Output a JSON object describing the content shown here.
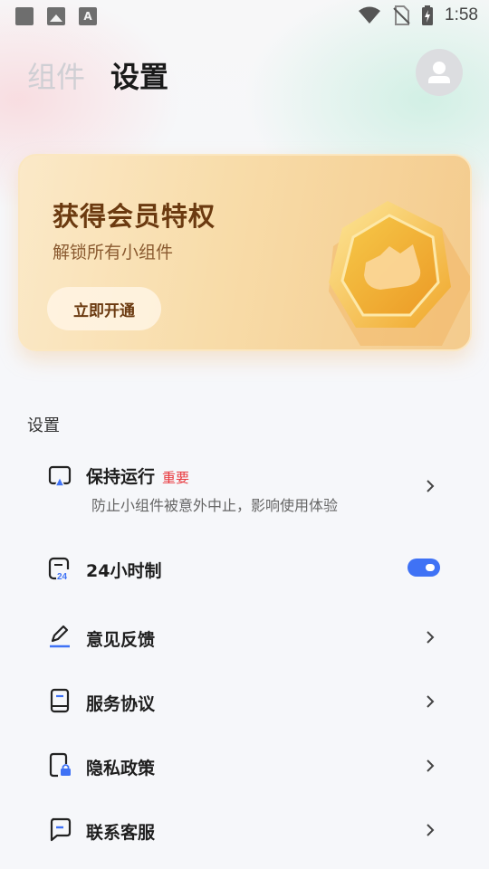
{
  "status_bar": {
    "time": "1:58",
    "left_icons": [
      "square-notification-icon",
      "image-notification-icon",
      "text-notification-icon"
    ],
    "right_icons": [
      "wifi-icon",
      "no-sim-icon",
      "battery-charging-icon"
    ]
  },
  "header": {
    "tabs": [
      {
        "label": "组件",
        "active": false
      },
      {
        "label": "设置",
        "active": true
      }
    ],
    "avatar_icon": "user-avatar-icon"
  },
  "banner": {
    "title": "获得会员特权",
    "subtitle": "解锁所有小组件",
    "button_label": "立即开通",
    "art_icon": "crown-hexagon-badge-icon"
  },
  "settings": {
    "section_label": "设置",
    "items": [
      {
        "label": "保持运行",
        "tag": "重要",
        "description": "防止小组件被意外中止，影响使用体验",
        "icon": "keep-running-icon",
        "control": "chevron"
      },
      {
        "label": "24小时制",
        "icon": "24-hour-clock-icon",
        "control": "toggle",
        "toggle_on": true
      },
      {
        "label": "意见反馈",
        "icon": "feedback-edit-icon",
        "control": "chevron"
      },
      {
        "label": "服务协议",
        "icon": "service-agreement-icon",
        "control": "chevron"
      },
      {
        "label": "隐私政策",
        "icon": "privacy-lock-icon",
        "control": "chevron"
      },
      {
        "label": "联系客服",
        "icon": "customer-service-chat-icon",
        "control": "chevron"
      }
    ]
  },
  "colors": {
    "accent_blue": "#3f72f5",
    "tag_red": "#e8383d",
    "banner_text": "#6b3a10",
    "background": "#f6f7fa"
  }
}
